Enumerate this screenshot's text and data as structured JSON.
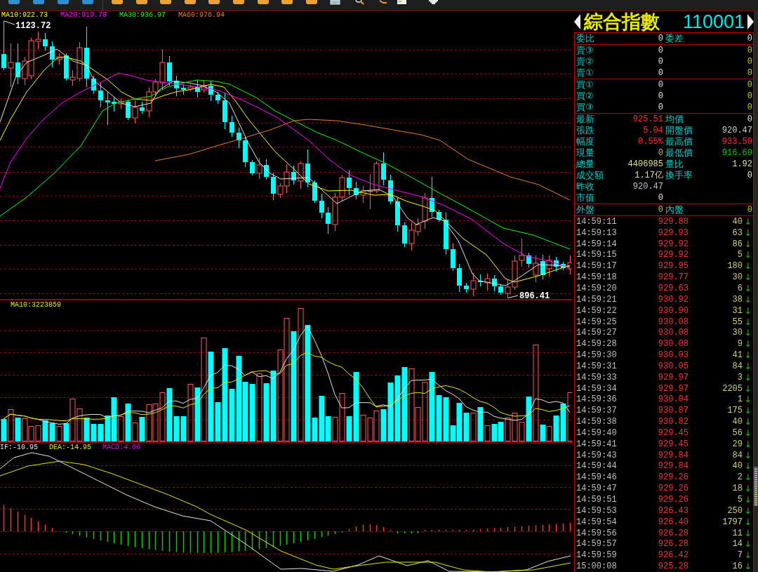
{
  "price_panel": {
    "legend": [
      {
        "text": "MA10:922.73",
        "color": "#ffff00"
      },
      {
        "text": "MA20:919.78",
        "color": "#ff00ff"
      },
      {
        "text": "MA30:936.97",
        "color": "#00ff00"
      },
      {
        "text": "MA60:976.94",
        "color": "#e08030"
      }
    ],
    "high_label": "1123.72",
    "low_label": "896.41"
  },
  "volume_panel": {
    "legend": [
      {
        "text": "MA10:3223859",
        "color": "#e6e600"
      }
    ]
  },
  "macd_panel": {
    "legend": [
      {
        "text": "IF:-10.95",
        "color": "#e6e6e6"
      },
      {
        "text": "DEA:-14.95",
        "color": "#e6e600"
      },
      {
        "text": "MACD:4.00",
        "color": "#e600e6"
      }
    ]
  },
  "quote": {
    "name": "綜合指數",
    "code": "110001",
    "sections": [
      {
        "rows": [
          [
            {
              "label": "委比",
              "value": "0",
              "color": "#e6e6e6"
            },
            {
              "label": "委差",
              "value": "0",
              "color": "#e6e6e6"
            }
          ]
        ]
      },
      {
        "rows": [
          [
            {
              "label": "賣③",
              "value": "0",
              "color": "#e6e6e6"
            },
            {
              "value": "0",
              "color": "#c8c800"
            }
          ],
          [
            {
              "label": "賣②",
              "value": "0",
              "color": "#e6e6e6"
            },
            {
              "value": "0",
              "color": "#c8c800"
            }
          ],
          [
            {
              "label": "賣①",
              "value": "0",
              "color": "#e6e6e6"
            },
            {
              "value": "0",
              "color": "#c8c800"
            }
          ]
        ]
      },
      {
        "rows": [
          [
            {
              "label": "買①",
              "value": "0",
              "color": "#e6e6e6"
            },
            {
              "value": "0",
              "color": "#c8c800"
            }
          ],
          [
            {
              "label": "買②",
              "value": "0",
              "color": "#e6e6e6"
            },
            {
              "value": "0",
              "color": "#c8c800"
            }
          ],
          [
            {
              "label": "買③",
              "value": "0",
              "color": "#e6e6e6"
            },
            {
              "value": "0",
              "color": "#c8c800"
            }
          ]
        ]
      },
      {
        "rows": [
          [
            {
              "label": "最新",
              "value": "925.51",
              "color": "#ff3030"
            },
            {
              "label": "均價",
              "value": "0",
              "color": "#e6e6e6"
            }
          ],
          [
            {
              "label": "張跌",
              "value": "5.04",
              "color": "#ff3030"
            },
            {
              "label": "開盤價",
              "value": "920.47",
              "color": "#d0d0d0"
            }
          ],
          [
            {
              "label": "幅度",
              "value": "0.55%",
              "color": "#ff3030"
            },
            {
              "label": "最高價",
              "value": "933.50",
              "color": "#ff3030"
            }
          ],
          [
            {
              "label": "現量",
              "value": "0",
              "color": "#c8c800"
            },
            {
              "label": "最低價",
              "value": "916.60",
              "color": "#00c800"
            }
          ],
          [
            {
              "label": "總量",
              "value": "4406985",
              "color": "#e0e090"
            },
            {
              "label": "量比",
              "value": "1.92",
              "color": "#e0e090"
            }
          ],
          [
            {
              "label": "成交額",
              "value": "1.17亿",
              "color": "#e0e090"
            },
            {
              "label": "換手率",
              "value": "0",
              "color": "#e6e6e6"
            }
          ],
          [
            {
              "label": "昨收",
              "value": "920.47",
              "color": "#c0c0c0"
            }
          ],
          [
            {
              "label": "市值",
              "value": "0",
              "color": "#e6e6e6"
            }
          ]
        ]
      },
      {
        "rows": [
          [
            {
              "label": "外盤",
              "value": "0",
              "color": "#c8c800"
            },
            {
              "label": "內盤",
              "value": "0",
              "color": "#c8c800"
            }
          ]
        ]
      }
    ]
  },
  "trades": [
    {
      "time": "14:59:11",
      "price": "929.88",
      "volume": "40",
      "arrow": "↓"
    },
    {
      "time": "14:59:13",
      "price": "929.93",
      "volume": "63",
      "arrow": "↓"
    },
    {
      "time": "14:59:14",
      "price": "929.92",
      "volume": "86",
      "arrow": "↓"
    },
    {
      "time": "14:59:15",
      "price": "929.92",
      "volume": "5",
      "arrow": "↓"
    },
    {
      "time": "14:59:17",
      "price": "929.95",
      "volume": "180",
      "arrow": "↓"
    },
    {
      "time": "14:59:18",
      "price": "929.77",
      "volume": "30",
      "arrow": "↓"
    },
    {
      "time": "14:59:20",
      "price": "929.63",
      "volume": "6",
      "arrow": "↓"
    },
    {
      "time": "14:59:21",
      "price": "930.92",
      "volume": "38",
      "arrow": "↓"
    },
    {
      "time": "14:59:22",
      "price": "930.90",
      "volume": "31",
      "arrow": "↓"
    },
    {
      "time": "14:59:25",
      "price": "930.08",
      "volume": "55",
      "arrow": "↓"
    },
    {
      "time": "14:59:27",
      "price": "930.08",
      "volume": "30",
      "arrow": "↓"
    },
    {
      "time": "14:59:28",
      "price": "930.08",
      "volume": "9",
      "arrow": "↓"
    },
    {
      "time": "14:59:30",
      "price": "930.03",
      "volume": "41",
      "arrow": "↓"
    },
    {
      "time": "14:59:31",
      "price": "930.05",
      "volume": "84",
      "arrow": "↓"
    },
    {
      "time": "14:59:33",
      "price": "929.97",
      "volume": "3",
      "arrow": "↓"
    },
    {
      "time": "14:59:34",
      "price": "929.97",
      "volume": "2205",
      "arrow": "↓"
    },
    {
      "time": "14:59:36",
      "price": "930.04",
      "volume": "1",
      "arrow": "↓"
    },
    {
      "time": "14:59:37",
      "price": "930.87",
      "volume": "175",
      "arrow": "↓"
    },
    {
      "time": "14:59:38",
      "price": "930.82",
      "volume": "40",
      "arrow": "↓"
    },
    {
      "time": "14:59:40",
      "price": "929.45",
      "volume": "56",
      "arrow": "↓"
    },
    {
      "time": "14:59:41",
      "price": "929.45",
      "volume": "29",
      "arrow": "↓"
    },
    {
      "time": "14:59:43",
      "price": "929.84",
      "volume": "84",
      "arrow": "↓"
    },
    {
      "time": "14:59:44",
      "price": "929.84",
      "volume": "40",
      "arrow": "↓"
    },
    {
      "time": "14:59:46",
      "price": "929.26",
      "volume": "2",
      "arrow": "↓"
    },
    {
      "time": "14:59:47",
      "price": "929.26",
      "volume": "18",
      "arrow": "↓"
    },
    {
      "time": "14:59:51",
      "price": "929.26",
      "volume": "5",
      "arrow": "↓"
    },
    {
      "time": "14:59:53",
      "price": "926.43",
      "volume": "250",
      "arrow": "↓"
    },
    {
      "time": "14:59:54",
      "price": "926.40",
      "volume": "1797",
      "arrow": "↓"
    },
    {
      "time": "14:59:56",
      "price": "926.28",
      "volume": "11",
      "arrow": "↓"
    },
    {
      "time": "14:59:57",
      "price": "926.28",
      "volume": "14",
      "arrow": "↓"
    },
    {
      "time": "14:59:59",
      "price": "926.42",
      "volume": "7",
      "arrow": "↓"
    },
    {
      "time": "15:00:08",
      "price": "925.28",
      "volume": "16",
      "arrow": "↓"
    }
  ]
}
